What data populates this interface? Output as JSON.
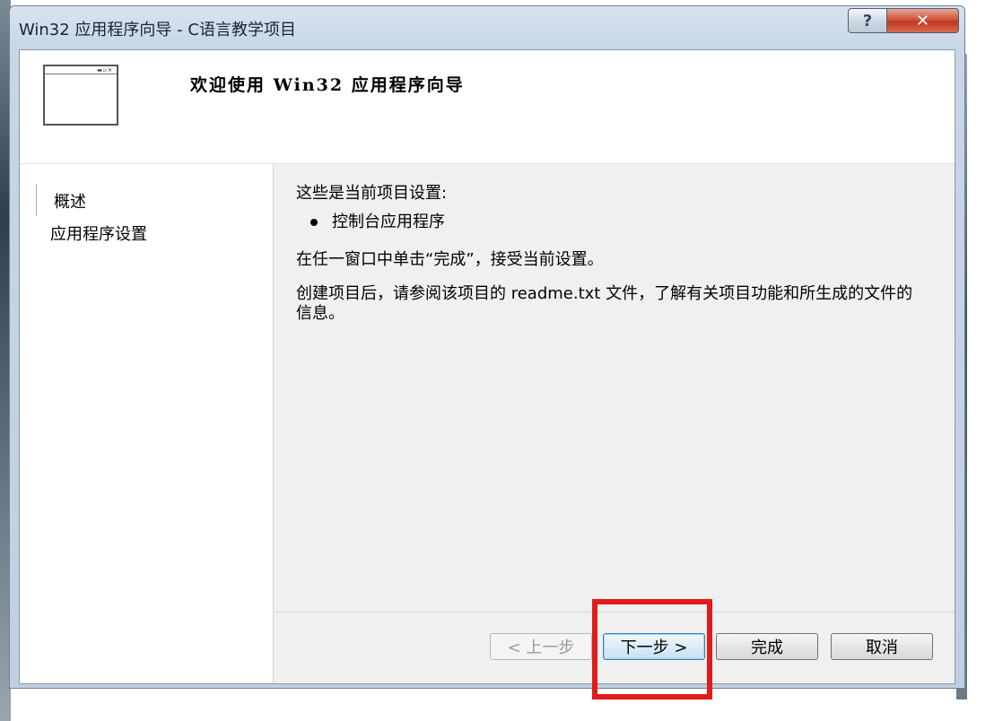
{
  "window": {
    "title": "Win32 应用程序向导 - C语言教学项目",
    "help_label": "?",
    "close_label": "✕"
  },
  "header": {
    "title": "欢迎使用 Win32 应用程序向导"
  },
  "sidebar": {
    "items": [
      {
        "label": "概述"
      },
      {
        "label": "应用程序设置"
      }
    ]
  },
  "content": {
    "intro": "这些是当前项目设置:",
    "settings": [
      "控制台应用程序"
    ],
    "finish_hint": "在任一窗口中单击“完成”，接受当前设置。",
    "readme_hint": "创建项目后，请参阅该项目的 readme.txt 文件，了解有关项目功能和所生成的文件的信息。"
  },
  "buttons": {
    "prev": "< 上一步",
    "next": "下一步 >",
    "finish": "完成",
    "cancel": "取消"
  },
  "colors": {
    "highlight": "#e21b1b",
    "close_button": "#c0391f",
    "default_button_border": "#3c7fb1"
  }
}
